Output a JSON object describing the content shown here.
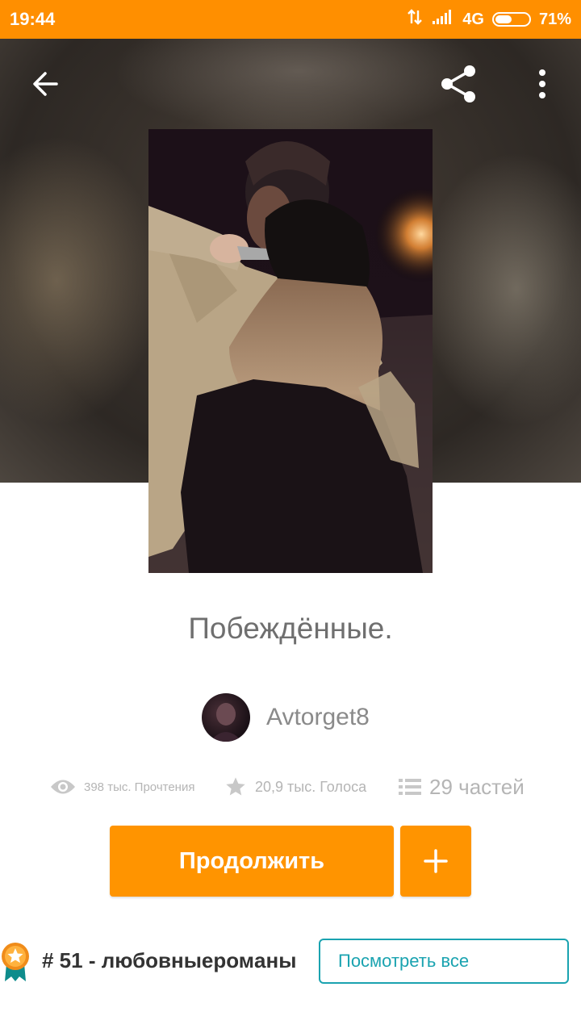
{
  "status_bar": {
    "time": "19:44",
    "network": "4G",
    "battery": "71%",
    "icons": [
      "data-transfer-icon",
      "signal-icon",
      "battery-icon"
    ]
  },
  "toolbar": {
    "icons": [
      "back-arrow-icon",
      "share-icon",
      "more-vert-icon"
    ]
  },
  "story": {
    "title": "Побеждённые.",
    "author": "Avtorget8",
    "reads": "398 тыс. Прочтения",
    "votes": "20,9 тыс. Голоса",
    "parts": "29 частей"
  },
  "actions": {
    "continue_label": "Продолжить",
    "add_label": "+"
  },
  "ranking": {
    "text": "# 51 - любовныеромaны",
    "see_all_label": "Посмотреть все"
  },
  "colors": {
    "accent": "#ff9400",
    "status_bar": "#ff8f00",
    "teal": "#1aa3b0"
  }
}
